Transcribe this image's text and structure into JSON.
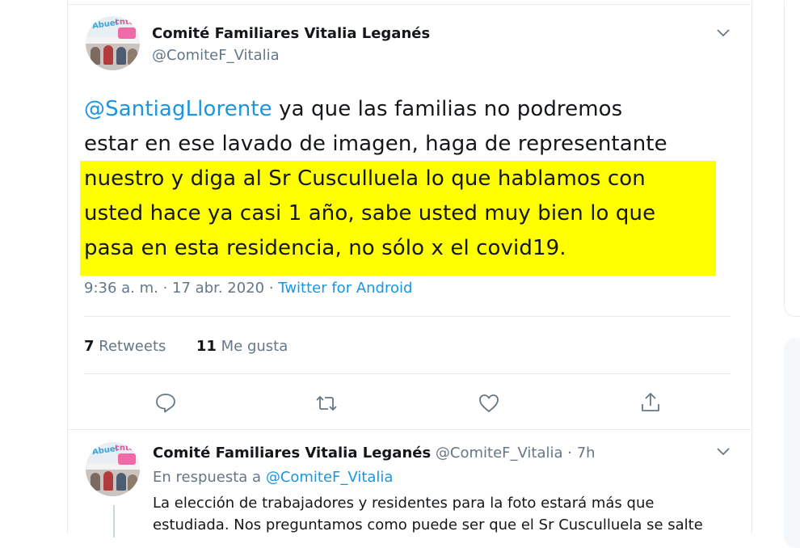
{
  "main_tweet": {
    "author_name": "Comité Familiares Vitalia Leganés",
    "author_handle": "@ComiteF_Vitalia",
    "avatar_text_left": "Abuel",
    "avatar_text_right": "cnta",
    "text_mention": "@SantiagLlorente",
    "text_line1": " ya que las familias no podremos",
    "text_line2": "estar en ese lavado de imagen, haga de representante",
    "text_line3": "nuestro y diga al Sr Cusculluela lo que hablamos con",
    "text_line4": "usted hace ya casi 1 año, sabe usted muy bien lo que",
    "text_line5": "pasa en esta residencia, no sólo x el covid19.",
    "timestamp": "9:36 a. m. · 17 abr. 2020 · ",
    "source": "Twitter for Android",
    "retweets_count": "7",
    "retweets_label": " Retweets",
    "likes_count": "11",
    "likes_label": " Me gusta",
    "highlight_color": "#ffff00"
  },
  "actions": {
    "reply_icon": "comment-icon",
    "retweet_icon": "retweet-icon",
    "like_icon": "heart-icon",
    "share_icon": "share-icon"
  },
  "reply_tweet": {
    "author_name": "Comité Familiares Vitalia Leganés",
    "author_handle_time": " @ComiteF_Vitalia · 7h",
    "in_reply_prefix": "En respuesta a ",
    "in_reply_mention": "@ComiteF_Vitalia",
    "body_line1": "La elección de trabajadores y residentes para la foto estará más que",
    "body_line2": "estudiada. Nos preguntamos como puede ser que el Sr Cusculluela se salte"
  },
  "colors": {
    "accent": "#1b95e0",
    "muted": "#657786",
    "text": "#14171a",
    "border": "#e6ecf0"
  }
}
